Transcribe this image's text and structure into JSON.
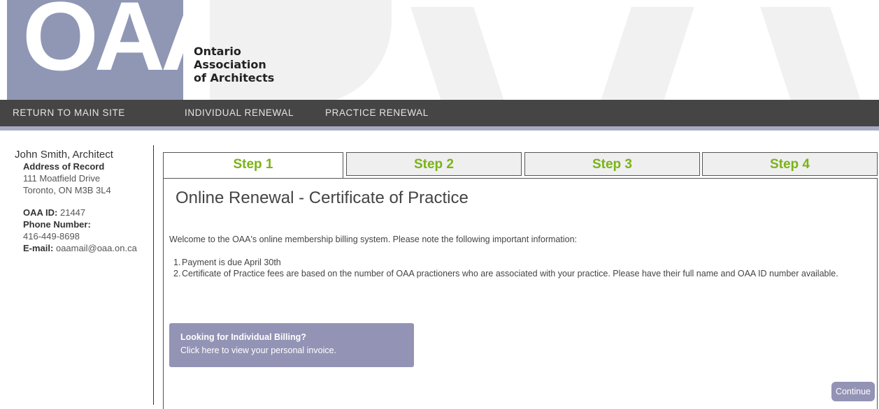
{
  "header": {
    "logo_text": "OAA",
    "org_name_line1": "Ontario",
    "org_name_line2": "Association",
    "org_name_line3": "of Architects"
  },
  "nav": {
    "items": [
      {
        "label": "RETURN TO MAIN SITE"
      },
      {
        "label": "INDIVIDUAL RENEWAL"
      },
      {
        "label": "PRACTICE RENEWAL"
      }
    ]
  },
  "sidebar": {
    "name": "John Smith, Architect",
    "address_heading": "Address of Record",
    "address_line1": "111 Moatfield Drive",
    "address_line2": "Toronto, ON M3B 3L4",
    "oaa_id_label": "OAA ID:",
    "oaa_id_value": "21447",
    "phone_label": "Phone Number:",
    "phone_value": "416-449-8698",
    "email_label": "E-mail:",
    "email_value": "oaamail@oaa.on.ca"
  },
  "steps": [
    {
      "label": "Step 1",
      "active": true
    },
    {
      "label": "Step 2",
      "active": false
    },
    {
      "label": "Step 3",
      "active": false
    },
    {
      "label": "Step 4",
      "active": false
    }
  ],
  "main": {
    "title": "Online Renewal - Certificate of Practice",
    "intro": "Welcome to the OAA's online membership billing system. Please note the following important information:",
    "notes": [
      {
        "num": "1.",
        "text": "Payment is due April 30th"
      },
      {
        "num": "2.",
        "text": "Certificate of Practice fees are based on the number of OAA practioners who are associated with your practice. Please have their full name and OAA ID number available."
      }
    ],
    "callout_title": "Looking for Individual Billing?",
    "callout_text": "Click here to view your personal invoice.",
    "continue_label": "Continue"
  },
  "colors": {
    "brand_purple": "#8f97b4",
    "nav_bg": "#454545",
    "step_green": "#7ab317",
    "button_purple": "#9393b5"
  }
}
